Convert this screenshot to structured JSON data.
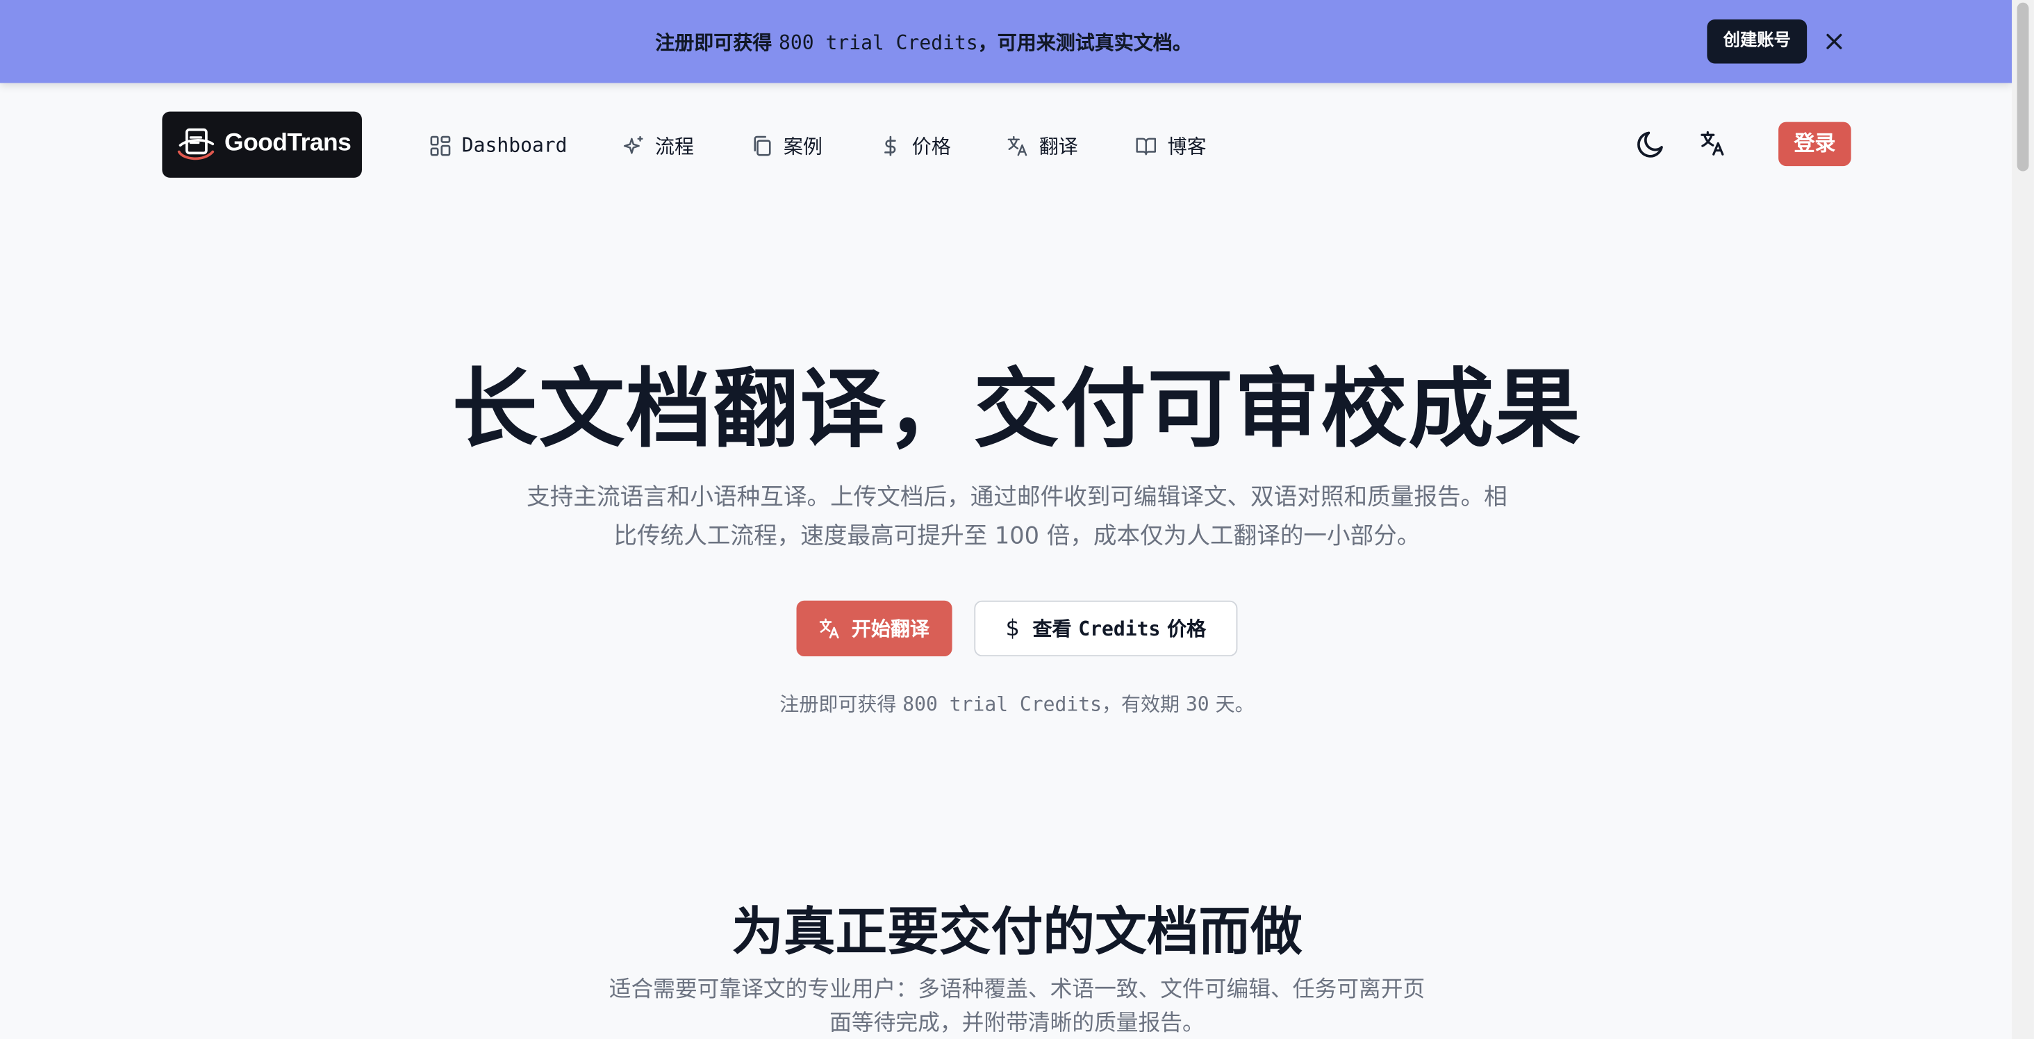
{
  "banner": {
    "text_before": "注册即可获得 ",
    "text_mono": "800 trial Credits",
    "text_after": "，可用来测试真实文档。",
    "button_label": "创建账号",
    "close_icon": "x-icon"
  },
  "nav": {
    "logo_text": "GoodTrans",
    "items": [
      {
        "label": "Dashboard",
        "icon": "grid-icon"
      },
      {
        "label": "流程",
        "icon": "sparkles-icon"
      },
      {
        "label": "案例",
        "icon": "copy-icon"
      },
      {
        "label": "价格",
        "icon": "dollar-icon"
      },
      {
        "label": "翻译",
        "icon": "translate-icon"
      },
      {
        "label": "博客",
        "icon": "book-icon"
      }
    ],
    "theme_icon": "moon-icon",
    "language_icon": "translate-icon",
    "login_label": "登录"
  },
  "hero": {
    "title": "长文档翻译，交付可审校成果",
    "subtitle": "支持主流语言和小语种互译。上传文档后，通过邮件收到可编辑译文、双语对照和质量报告。相比传统人工流程，速度最高可提升至 100 倍，成本仅为人工翻译的一小部分。",
    "primary_cta": "开始翻译",
    "secondary_cta_prefix": "查看 ",
    "secondary_cta_mono": "Credits",
    "secondary_cta_suffix": " 价格",
    "note_before": "注册即可获得 ",
    "note_mono": "800 trial Credits",
    "note_mid": "，有效期 ",
    "note_days": "30",
    "note_after": " 天。"
  },
  "section": {
    "title": "为真正要交付的文档而做",
    "subtitle": "适合需要可靠译文的专业用户：多语种覆盖、术语一致、文件可编辑、任务可离开页面等待完成，并附带清晰的质量报告。"
  },
  "colors": {
    "banner_bg": "#8490ef",
    "accent": "#d95f56",
    "dark": "#111827",
    "muted": "#6b7280"
  }
}
